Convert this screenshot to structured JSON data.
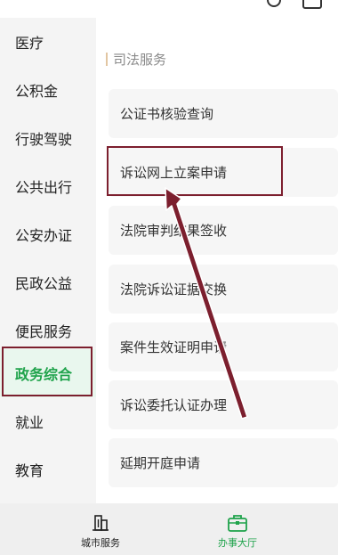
{
  "sidebar": {
    "items": [
      {
        "label": "医疗"
      },
      {
        "label": "公积金"
      },
      {
        "label": "行驶驾驶"
      },
      {
        "label": "公共出行"
      },
      {
        "label": "公安办证"
      },
      {
        "label": "民政公益"
      },
      {
        "label": "便民服务"
      },
      {
        "label": "政务综合",
        "active": true
      },
      {
        "label": "就业"
      },
      {
        "label": "教育"
      }
    ]
  },
  "main": {
    "section_title": "司法服务",
    "services": [
      {
        "label": "公证书核验查询"
      },
      {
        "label": "诉讼网上立案申请"
      },
      {
        "label": "法院审判结果签收"
      },
      {
        "label": "法院诉讼证据交换"
      },
      {
        "label": "案件生效证明申请"
      },
      {
        "label": "诉讼委托认证办理"
      },
      {
        "label": "延期开庭申请"
      }
    ]
  },
  "bottom_nav": {
    "tabs": [
      {
        "label": "城市服务",
        "icon": "building-icon"
      },
      {
        "label": "办事大厅",
        "icon": "briefcase-icon",
        "active": true
      }
    ]
  },
  "colors": {
    "accent": "#1fa34b",
    "highlight": "#7c1f2e"
  }
}
